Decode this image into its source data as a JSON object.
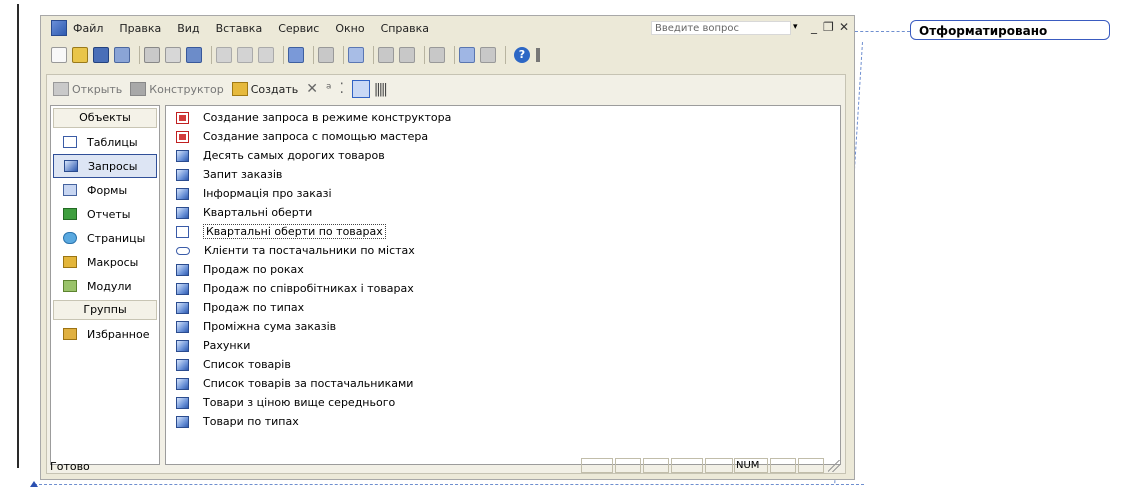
{
  "comment": {
    "text": "Отформатировано"
  },
  "menu": {
    "items": [
      "Файл",
      "Правка",
      "Вид",
      "Вставка",
      "Сервис",
      "Окно",
      "Справка"
    ],
    "question_placeholder": "Введите вопрос"
  },
  "db_toolbar": {
    "open": "Открыть",
    "design": "Конструктор",
    "create": "Создать"
  },
  "objects": {
    "header": "Объекты",
    "items": [
      "Таблицы",
      "Запросы",
      "Формы",
      "Отчеты",
      "Страницы",
      "Макросы",
      "Модули"
    ],
    "selected": "Запросы",
    "groups_header": "Группы",
    "groups": [
      "Избранное"
    ]
  },
  "list": {
    "items": [
      {
        "label": "Создание запроса в режиме конструктора",
        "icon": "wizard-icon"
      },
      {
        "label": "Создание запроса с помощью мастера",
        "icon": "wizard-icon"
      },
      {
        "label": "Десять самых дорогих товаров",
        "icon": "query-icon"
      },
      {
        "label": "Запит заказів",
        "icon": "query-icon"
      },
      {
        "label": "Інформація про заказі",
        "icon": "query-icon"
      },
      {
        "label": "Квартальні оберти",
        "icon": "query-icon"
      },
      {
        "label": "Квартальні оберти по товарах",
        "icon": "crosstab-icon"
      },
      {
        "label": "Клієнти та постачальники по містах",
        "icon": "union-icon"
      },
      {
        "label": "Продаж по роках",
        "icon": "query-icon"
      },
      {
        "label": "Продаж по співробітниках і товарах",
        "icon": "query-icon"
      },
      {
        "label": "Продаж по типах",
        "icon": "query-icon"
      },
      {
        "label": "Проміжна сума заказів",
        "icon": "query-icon"
      },
      {
        "label": "Рахунки",
        "icon": "query-icon"
      },
      {
        "label": "Список товарів",
        "icon": "query-icon"
      },
      {
        "label": "Список товарів за постачальниками",
        "icon": "query-icon"
      },
      {
        "label": "Товари з ціною вище середнього",
        "icon": "query-icon"
      },
      {
        "label": "Товари по типах",
        "icon": "query-icon"
      }
    ]
  },
  "status": {
    "text": "Готово",
    "num": "NUM"
  }
}
